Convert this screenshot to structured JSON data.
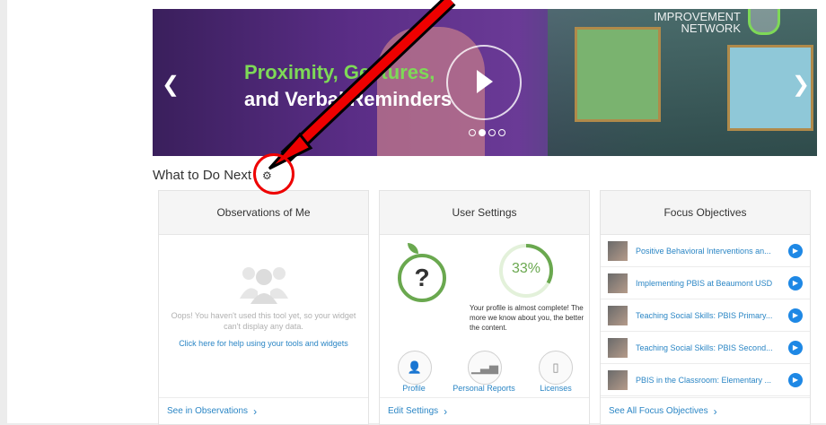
{
  "banner": {
    "title_line1": "Proximity, Gestures,",
    "title_line2": "and Verbal Reminders",
    "brand_line1": "IMPROVEMENT",
    "brand_line2": "NETWORK",
    "prev_icon": "chevron-left-icon",
    "next_icon": "chevron-right-icon",
    "play_icon": "play-icon"
  },
  "section": {
    "title": "What to Do Next",
    "settings_icon": "gear-icon"
  },
  "observations": {
    "title": "Observations of Me",
    "empty_text": "Oops! You haven't used this tool yet, so your widget can't display any data.",
    "help_link": "Click here for help using your tools and widgets",
    "footer_link": "See in Observations"
  },
  "user_settings": {
    "title": "User Settings",
    "progress_label": "33%",
    "progress_value": 0.33,
    "profile_text": "Your profile is almost complete! The more we know about you, the better the content.",
    "links": [
      {
        "label": "Profile",
        "icon": "user-icon"
      },
      {
        "label": "Personal Reports",
        "icon": "bar-chart-icon"
      },
      {
        "label": "Licenses",
        "icon": "document-icon"
      }
    ],
    "footer_link": "Edit Settings"
  },
  "focus_objectives": {
    "title": "Focus Objectives",
    "items": [
      {
        "label": "Positive Behavioral Interventions an..."
      },
      {
        "label": "Implementing PBIS at Beaumont USD"
      },
      {
        "label": "Teaching Social Skills: PBIS Primary..."
      },
      {
        "label": "Teaching Social Skills: PBIS Second..."
      },
      {
        "label": "PBIS in the Classroom: Elementary ..."
      }
    ],
    "footer_link": "See All Focus Objectives"
  },
  "colors": {
    "accent": "#2b86c5",
    "green": "#6aa84f",
    "annotation": "#e00000"
  }
}
